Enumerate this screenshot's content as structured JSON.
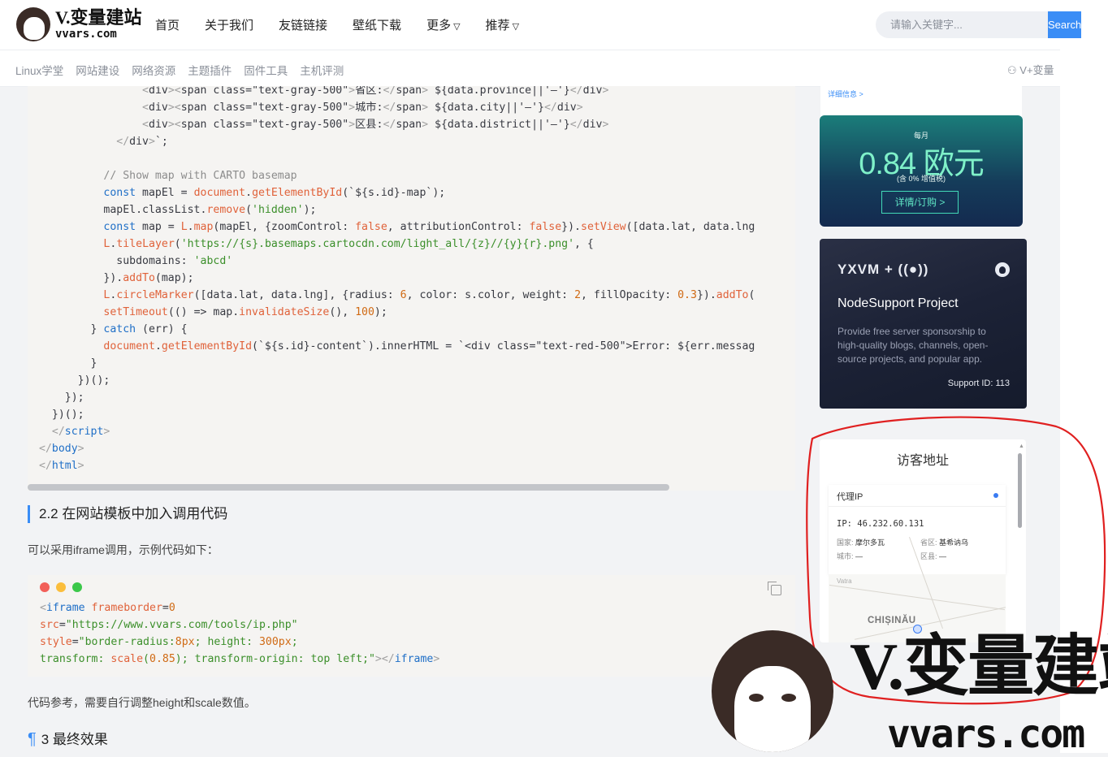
{
  "header": {
    "logo_title": "V.变量建站",
    "logo_sub": "vvars.com",
    "nav": [
      "首页",
      "关于我们",
      "友链链接",
      "壁纸下载",
      "更多",
      "推荐"
    ],
    "search_placeholder": "请输入关键字...",
    "search_button": "Search"
  },
  "subnav": {
    "items": [
      "Linux学堂",
      "网站建设",
      "网络资源",
      "主题插件",
      "固件工具",
      "主机评测"
    ],
    "user": "V+变量"
  },
  "article": {
    "h2": "2.2 在网站模板中加入调用代码",
    "p1": "可以采用iframe调用，示例代码如下：",
    "p2": "代码参考，需要自行调整height和scale数值。",
    "h3": "3 最终效果"
  },
  "sidebar": {
    "detail_link": "详细信息 >",
    "ad1": {
      "per_month": "每月",
      "price": "0.84 欧元",
      "vat": "(含 0% 增值税)",
      "button": "详情/订购 >"
    },
    "ad2": {
      "logo": "YXVM + ((●))",
      "title": "NodeSupport Project",
      "desc": "Provide free server sponsorship to high-quality blogs, channels, open-source projects, and popular app.",
      "support_id": "Support ID: 113"
    },
    "visitor": {
      "title": "访客地址",
      "card_header": "代理IP",
      "ip": "IP: 46.232.60.131",
      "country_label": "国家:",
      "country": "摩尔多瓦",
      "province_label": "省区:",
      "province": "基希讷乌",
      "city_label": "城市:",
      "city": "—",
      "district_label": "区县:",
      "district": "—",
      "map_label_small": "Vatra",
      "map_city": "CHIȘINĂU"
    }
  },
  "watermark": {
    "title": "V.变量建站",
    "sub": "vvars.com"
  },
  "colors": {
    "accent": "#3a8df6",
    "annotation": "#e02020"
  }
}
